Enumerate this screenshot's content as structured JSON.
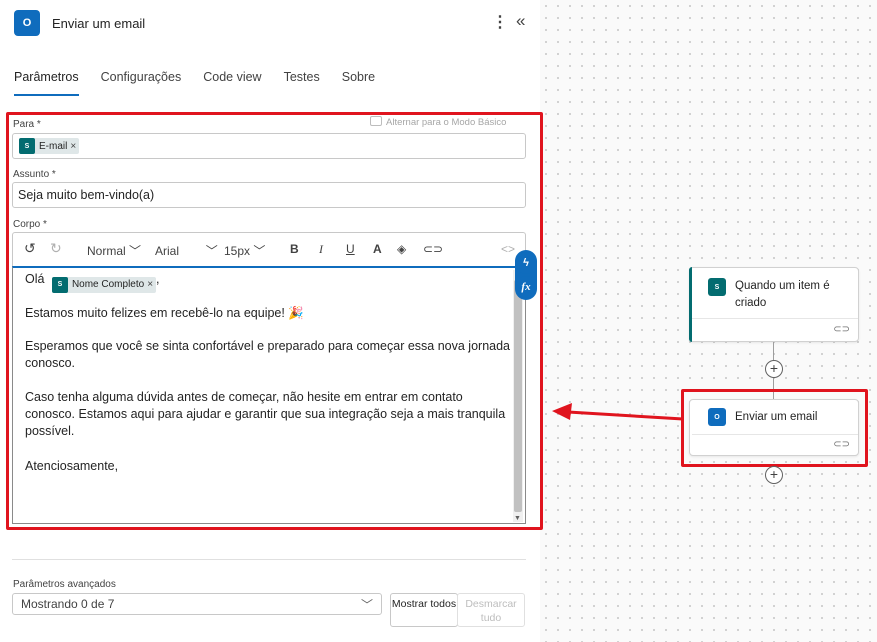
{
  "header": {
    "icon_text": "O",
    "title": "Enviar um email"
  },
  "tabs": [
    "Parâmetros",
    "Configurações",
    "Code view",
    "Testes",
    "Sobre"
  ],
  "switch_mode": "Alternar para o Modo Básico",
  "fields": {
    "to": {
      "label": "Para *",
      "token_icon": "S",
      "token": "E-mail"
    },
    "subject": {
      "label": "Assunto *",
      "value": "Seja muito bem-vindo(a)"
    },
    "body": {
      "label": "Corpo *"
    }
  },
  "toolbar": {
    "paragraph_style": "Normal",
    "font": "Arial",
    "size": "15px",
    "bold": "B",
    "italic": "I",
    "underline": "U",
    "font_color": "A"
  },
  "body": {
    "greeting": "Olá",
    "token": "Nome Completo",
    "token_after": ",",
    "paragraphs": [
      "Estamos muito felizes em recebê-lo na equipe! 🎉",
      "Esperamos que você se sinta confortável e preparado para começar essa nova jornada conosco.",
      "Caso tenha alguma dúvida antes de começar, não hesite em entrar em contato conosco. Estamos aqui para ajudar e garantir que sua integração seja a mais tranquila possível.",
      "Atenciosamente,"
    ]
  },
  "advanced": {
    "label": "Parâmetros avançados",
    "select_value": "Mostrando 0 de 7",
    "show_all": "Mostrar todos",
    "clear_all": "Desmarcar tudo"
  },
  "flow": {
    "trigger": {
      "title": "Quando um item é criado",
      "icon_text": "S"
    },
    "action": {
      "title": "Enviar um email",
      "icon_text": "O"
    }
  },
  "colors": {
    "accent": "#0f6cbd",
    "highlight": "#e0141e",
    "sharepoint": "#036c70",
    "outlook": "#0f6cbd"
  }
}
